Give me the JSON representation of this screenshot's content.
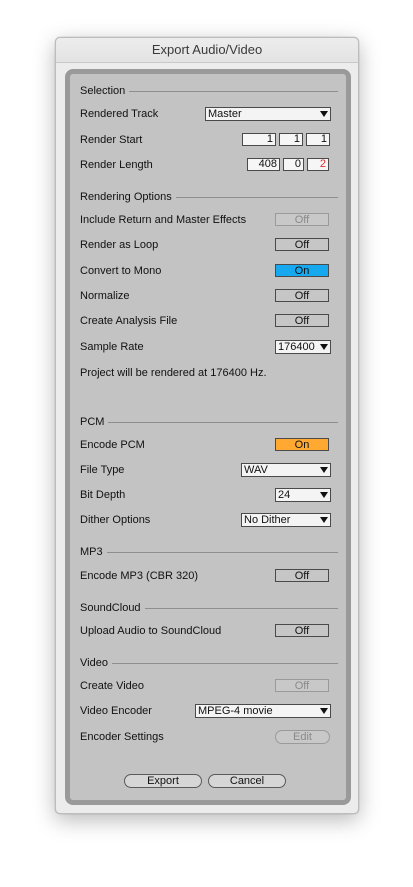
{
  "window": {
    "title": "Export Audio/Video"
  },
  "selection": {
    "header": "Selection",
    "rendered_track_label": "Rendered Track",
    "rendered_track_value": "Master",
    "render_start_label": "Render Start",
    "render_start": [
      "1",
      "1",
      "1"
    ],
    "render_length_label": "Render Length",
    "render_length": [
      "408",
      "0",
      "2"
    ]
  },
  "rendering": {
    "header": "Rendering Options",
    "return_master_label": "Include Return and Master Effects",
    "return_master_value": "Off",
    "loop_label": "Render as Loop",
    "loop_value": "Off",
    "mono_label": "Convert to Mono",
    "mono_value": "On",
    "normalize_label": "Normalize",
    "normalize_value": "Off",
    "analysis_label": "Create Analysis File",
    "analysis_value": "Off",
    "sample_rate_label": "Sample Rate",
    "sample_rate_value": "176400",
    "info": "Project will be rendered at 176400 Hz."
  },
  "pcm": {
    "header": "PCM",
    "encode_label": "Encode PCM",
    "encode_value": "On",
    "file_type_label": "File Type",
    "file_type_value": "WAV",
    "bit_depth_label": "Bit Depth",
    "bit_depth_value": "24",
    "dither_label": "Dither Options",
    "dither_value": "No Dither"
  },
  "mp3": {
    "header": "MP3",
    "encode_label": "Encode MP3 (CBR 320)",
    "encode_value": "Off"
  },
  "soundcloud": {
    "header": "SoundCloud",
    "upload_label": "Upload Audio to SoundCloud",
    "upload_value": "Off"
  },
  "video": {
    "header": "Video",
    "create_label": "Create Video",
    "create_value": "Off",
    "encoder_label": "Video Encoder",
    "encoder_value": "MPEG-4 movie",
    "settings_label": "Encoder Settings",
    "settings_button": "Edit"
  },
  "buttons": {
    "export": "Export",
    "cancel": "Cancel"
  },
  "colors": {
    "on_blue": "#16a9ef",
    "on_orange": "#ffa933",
    "panel_bg": "#c3c3c3"
  }
}
